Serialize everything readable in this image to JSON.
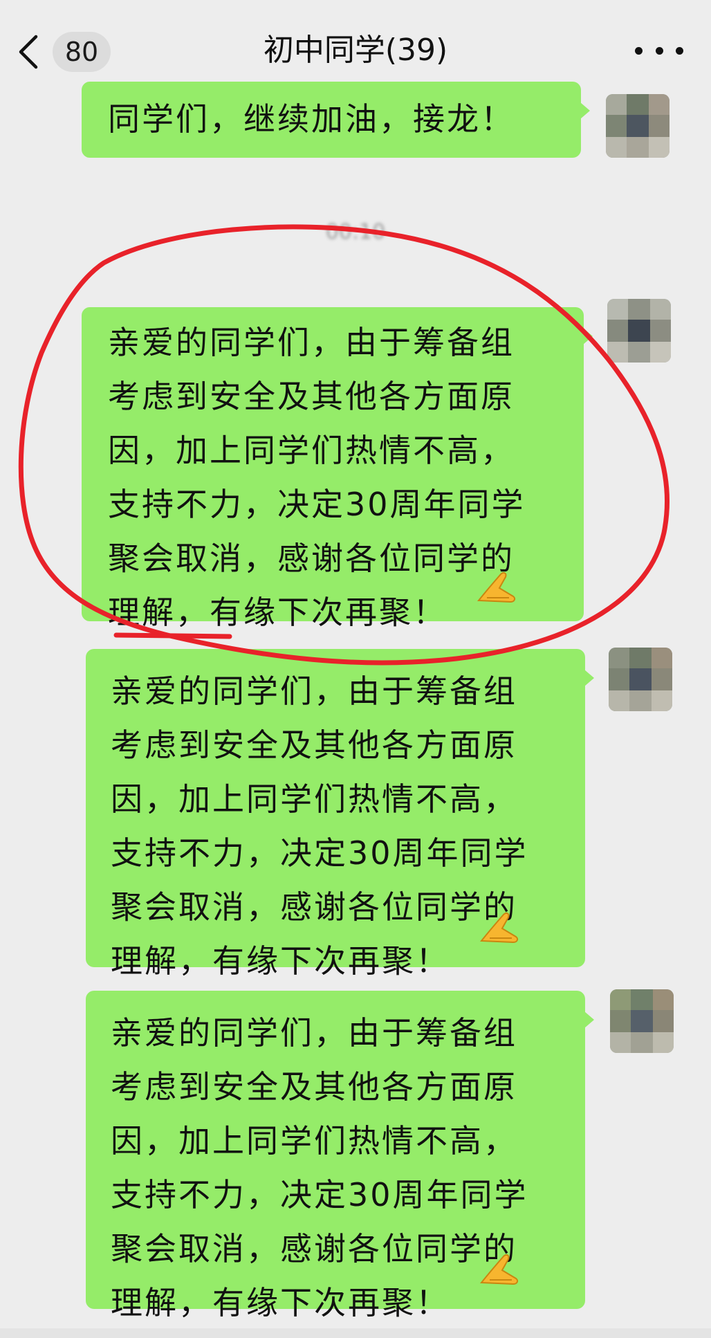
{
  "header": {
    "title": "初中同学(39)",
    "unread_count": "80",
    "back_icon": "chevron-left-icon",
    "more_icon": "ellipsis-icon"
  },
  "timestamp": "00:10",
  "messages": [
    {
      "sender": "self",
      "text": "同学们，继续加油，接龙！"
    },
    {
      "sender": "self",
      "text": "亲爱的同学们，由于筹备组\n考虑到安全及其他各方面原\n因，加上同学们热情不高，\n支持不力，决定30周年同学\n聚会取消，感谢各位同学的\n理解，有缘下次再聚！"
    },
    {
      "sender": "self",
      "text": "亲爱的同学们，由于筹备组\n考虑到安全及其他各方面原\n因，加上同学们热情不高，\n支持不力，决定30周年同学\n聚会取消，感谢各位同学的\n理解，有缘下次再聚！"
    },
    {
      "sender": "self",
      "text": "亲爱的同学们，由于筹备组\n考虑到安全及其他各方面原\n因，加上同学们热情不高，\n支持不力，决定30周年同学\n聚会取消，感谢各位同学的\n理解，有缘下次再聚！"
    }
  ],
  "emoji": "praying-hands-emoji",
  "colors": {
    "background": "#ededed",
    "bubble": "#95ec69",
    "annotation": "#e8222a"
  }
}
